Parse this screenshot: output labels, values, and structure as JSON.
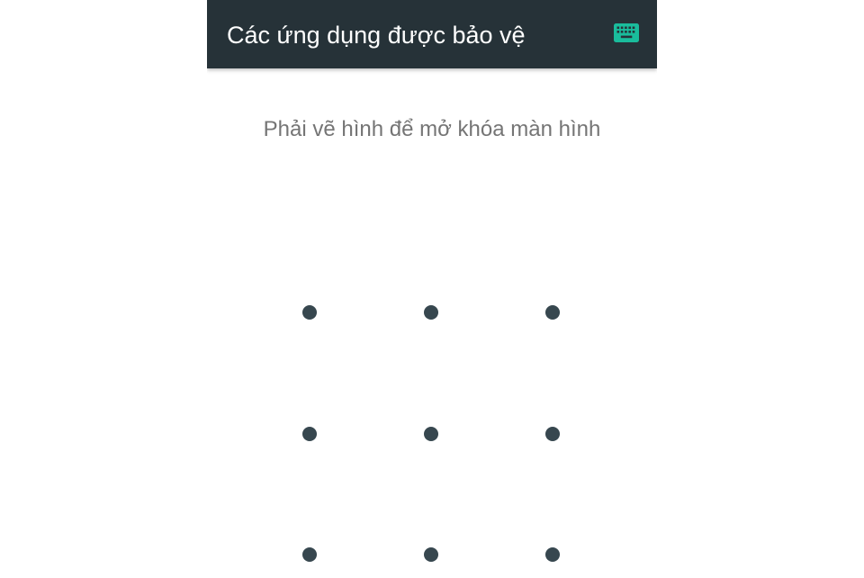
{
  "toolbar": {
    "title": "Các ứng dụng được bảo vệ",
    "keyboard_icon": "keyboard-icon",
    "background_color": "#263238",
    "icon_color": "#1abc9c"
  },
  "lock_screen": {
    "prompt": "Phải vẽ hình để mở khóa màn hình",
    "dot_color": "#37474f",
    "pattern_grid": {
      "rows": 3,
      "columns": 3
    }
  }
}
